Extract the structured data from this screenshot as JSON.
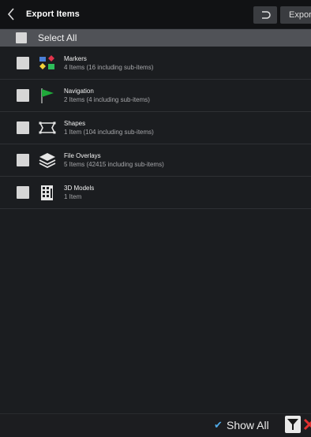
{
  "header": {
    "title": "Export Items",
    "export_label": "Export"
  },
  "select_all": {
    "label": "Select All"
  },
  "items": [
    {
      "name": "Markers",
      "sub": "4 Items (16 including sub-items)",
      "icon": "markers-icon"
    },
    {
      "name": "Navigation",
      "sub": "2 Items (4 including sub-items)",
      "icon": "navigation-flag-icon"
    },
    {
      "name": "Shapes",
      "sub": "1 Item (104 including sub-items)",
      "icon": "shapes-icon"
    },
    {
      "name": "File Overlays",
      "sub": "5 Items (42415 including sub-items)",
      "icon": "layers-icon"
    },
    {
      "name": "3D Models",
      "sub": "1 Item",
      "icon": "building-icon"
    }
  ],
  "footer": {
    "show_all_label": "Show All",
    "show_all_checked": true
  },
  "colors": {
    "accent_check": "#4fa9e6",
    "flag_green": "#1faa3a",
    "close_red": "#e03030"
  }
}
